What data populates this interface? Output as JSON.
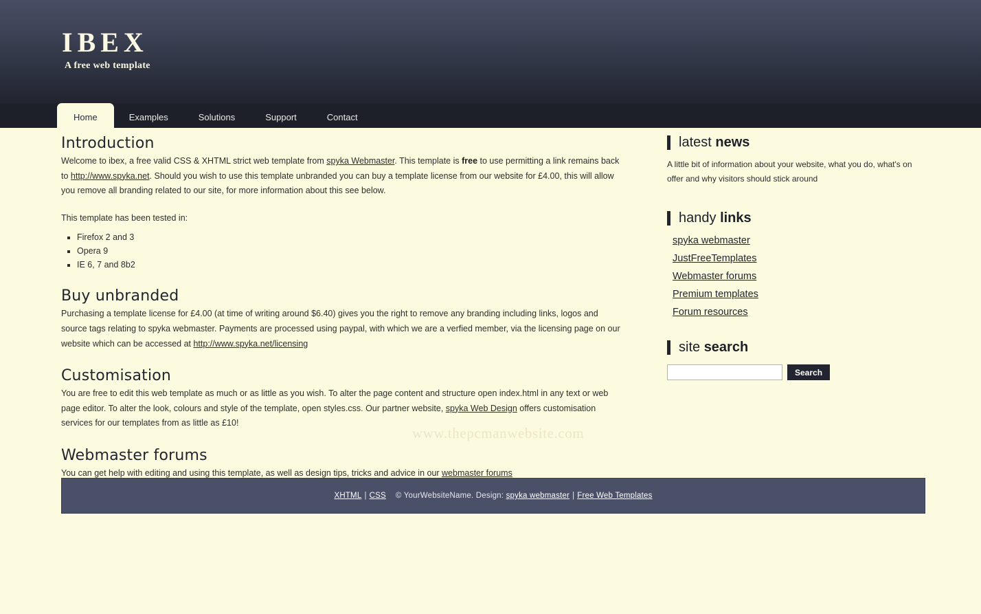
{
  "site": {
    "logo_title": "IBEX",
    "logo_tagline": "A free web template"
  },
  "nav": {
    "items": [
      {
        "label": "Home",
        "active": true
      },
      {
        "label": "Examples",
        "active": false
      },
      {
        "label": "Solutions",
        "active": false
      },
      {
        "label": "Support",
        "active": false
      },
      {
        "label": "Contact",
        "active": false
      }
    ]
  },
  "watermark": "www.thepcmanwebsite.com",
  "content": {
    "introduction": {
      "heading": "Introduction",
      "p1_a": "Welcome to ibex, a free valid CSS & XHTML strict web template from ",
      "p1_link1": "spyka Webmaster",
      "p1_b": ". This template is ",
      "p1_strong": "free",
      "p1_c": " to use permitting a link remains back to ",
      "p1_link2": "http://www.spyka.net",
      "p1_d": ". Should you wish to use this template unbranded you can buy a template license from our website for £4.00, this will allow you remove all branding related to our site, for more information about this see below.",
      "p2": "This template has been tested in:",
      "tested_in": [
        "Firefox 2 and 3",
        "Opera 9",
        "IE 6, 7 and 8b2"
      ]
    },
    "buy_unbranded": {
      "heading": "Buy unbranded",
      "p1_a": "Purchasing a template license for £4.00 (at time of writing around $6.40) gives you the right to remove any branding including links, logos and source tags relating to spyka webmaster. Payments are processed using paypal, with which we are a verfied member, via the licensing page on our website which can be accessed at ",
      "p1_link": "http://www.spyka.net/licensing"
    },
    "customisation": {
      "heading": "Customisation",
      "p1_a": "You are free to edit this web template as much or as little as you wish. To alter the page content and structure open index.html in any text or web page editor. To alter the look, colours and style of the template, open styles.css. Our partner website, ",
      "p1_link": "spyka Web Design",
      "p1_b": " offers customisation services for our templates from as little as £10!"
    },
    "webmaster_forums": {
      "heading": "Webmaster forums",
      "p1_a": "You can get help with editing and using this template, as well as design tips, tricks and advice in our ",
      "p1_link": "webmaster forums"
    }
  },
  "sidebar": {
    "news": {
      "heading_light": "latest ",
      "heading_bold": "news",
      "text": "A little bit of information about your website, what you do, what's on offer and why visitors should stick around"
    },
    "links": {
      "heading_light": "handy ",
      "heading_bold": "links",
      "items": [
        "spyka webmaster",
        "JustFreeTemplates",
        "Webmaster forums",
        "Premium templates",
        "Forum resources"
      ]
    },
    "search": {
      "heading_light": "site ",
      "heading_bold": "search",
      "input_value": "",
      "input_placeholder": "",
      "button_label": "Search"
    }
  },
  "footer": {
    "xhtml": "XHTML",
    "sep1": "|",
    "css": "CSS",
    "copyright": "© YourWebsiteName. Design:",
    "design_link": "spyka webmaster",
    "sep2": "|",
    "templates_link": "Free Web Templates"
  }
}
